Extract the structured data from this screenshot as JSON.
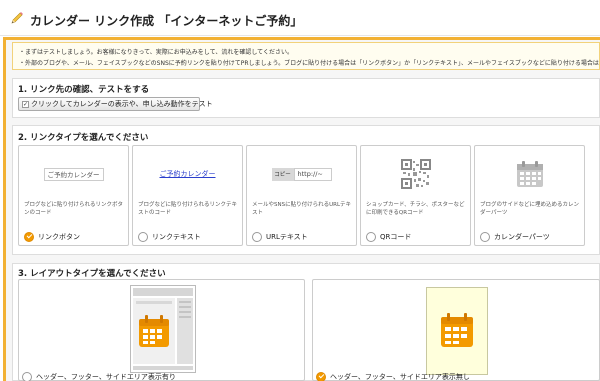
{
  "header": {
    "title": "カレンダー リンク作成 「インターネットご予約」",
    "icon": "pencil-icon"
  },
  "notice": {
    "line1": "・まずはテストしましょう。お客様になりきって、実際にお申込みをして、流れを確認してください。",
    "line2": "・外部のブログや、メール、フェイスブックなどのSNSに予約リンクを貼り付けてPRしましょう。ブログに貼り付ける場合は「リンクボタン」か「リンクテキスト」、メールやフェイスブックなどに貼り付ける場合は「URLテキ"
  },
  "section1": {
    "title": "1. リンク先の確認、テストをする",
    "test_button": "クリックしてカレンダーの表示や、申し込み動作をテスト"
  },
  "section2": {
    "title": "2. リンクタイプを選んでください",
    "cards": [
      {
        "preview": "ご予約カレンダー",
        "desc": "ブログなどに貼り付けられるリンクボタンのコード",
        "label": "リンクボタン",
        "checked": true
      },
      {
        "preview": "ご予約カレンダー",
        "desc": "ブログなどに貼り付けられるリンクテキストのコード",
        "label": "リンクテキスト",
        "checked": false
      },
      {
        "preview_copy": "コピー",
        "preview_url": "http://~",
        "desc": "メールやSNSに貼り付けられるURLテキスト",
        "label": "URLテキスト",
        "checked": false
      },
      {
        "preview": "qr-code-icon",
        "desc": "ショップカード、チラシ、ポスターなどに印刷できるQRコード",
        "label": "QRコード",
        "checked": false
      },
      {
        "preview": "calendar-icon",
        "desc": "ブログのサイドなどに埋め込めるカレンダーパーツ",
        "label": "カレンダーパーツ",
        "checked": false
      }
    ]
  },
  "section3": {
    "title": "3. レイアウトタイプを選んでください",
    "options": [
      {
        "label": "ヘッダー、フッター、サイドエリア表示有り",
        "checked": false
      },
      {
        "label": "ヘッダー、フッター、サイドエリア表示無し",
        "checked": true
      }
    ]
  },
  "colors": {
    "accent": "#f2b134",
    "checked": "#f39a00",
    "calendar_orange": "#f39a00",
    "link_blue": "#2a3ecc"
  }
}
